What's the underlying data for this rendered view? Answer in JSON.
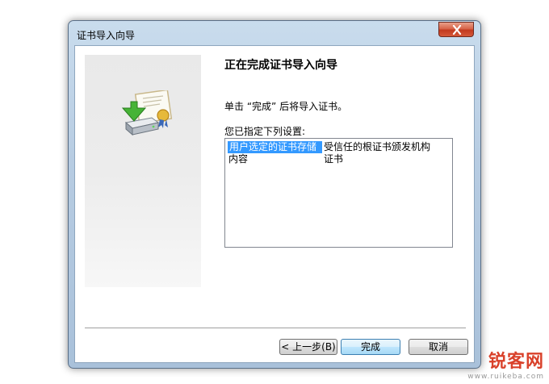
{
  "window": {
    "title": "证书导入向导",
    "close_symbol": "✕"
  },
  "wizard": {
    "heading": "正在完成证书导入向导",
    "instruction": "单击 “完成” 后将导入证书。",
    "settings_label": "您已指定下列设置:",
    "settings": [
      {
        "key": "用户选定的证书存储",
        "value": "受信任的根证书颁发机构",
        "selected": true
      },
      {
        "key": "内容",
        "value": "证书",
        "selected": false
      }
    ]
  },
  "buttons": {
    "back": "< 上一步(B)",
    "finish": "完成",
    "cancel": "取消"
  },
  "watermark": {
    "brand": "锐客网",
    "url": "www.ruikeba.com"
  },
  "colors": {
    "selection": "#3399ff",
    "close_button": "#c23a1f",
    "watermark": "#d9412a"
  },
  "icons": [
    "certificate-import-icon",
    "close-icon"
  ]
}
